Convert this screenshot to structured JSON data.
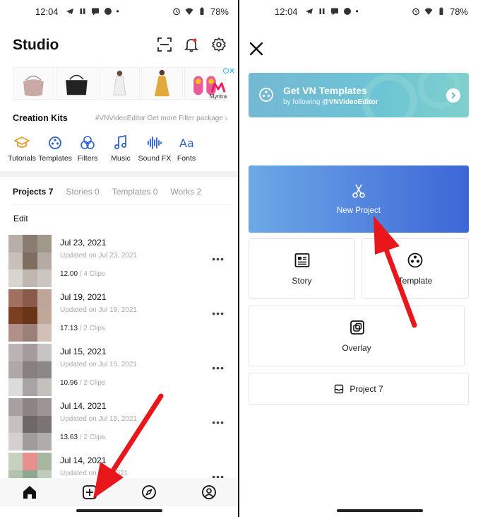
{
  "left_screen": {
    "status_bar": {
      "time": "12:04",
      "battery": "78%"
    },
    "header": {
      "title": "Studio",
      "icons": [
        "scan-icon",
        "bell-icon",
        "gear-icon"
      ]
    },
    "ad": {
      "brand": "Myntra"
    },
    "creation_kits": {
      "title": "Creation Kits",
      "more_text": "#VNVideoEditor Get more Filter package",
      "items": [
        {
          "label": "Tutorials",
          "icon": "graduation-cap-icon"
        },
        {
          "label": "Templates",
          "icon": "film-reel-icon"
        },
        {
          "label": "Filters",
          "icon": "filters-icon"
        },
        {
          "label": "Music",
          "icon": "music-note-icon"
        },
        {
          "label": "Sound FX",
          "icon": "sound-wave-icon"
        },
        {
          "label": "Fonts",
          "icon": "font-icon"
        }
      ]
    },
    "tabs": [
      {
        "label": "Projects 7"
      },
      {
        "label": "Stories 0"
      },
      {
        "label": "Templates 0"
      },
      {
        "label": "Works 2"
      }
    ],
    "edit_label": "Edit",
    "projects": [
      {
        "date": "Jul 23, 2021",
        "updated": "Updated on Jul 23, 2021",
        "duration": "12.00",
        "clips": "/ 4 Clips"
      },
      {
        "date": "Jul 19, 2021",
        "updated": "Updated on Jul 19, 2021",
        "duration": "17.13",
        "clips": "/ 2 Clips"
      },
      {
        "date": "Jul 15, 2021",
        "updated": "Updated on Jul 15, 2021",
        "duration": "10.96",
        "clips": "/ 2 Clips"
      },
      {
        "date": "Jul 14, 2021",
        "updated": "Updated on Jul 15, 2021",
        "duration": "13.63",
        "clips": "/ 2 Clips"
      },
      {
        "date": "Jul 14, 2021",
        "updated": "Updated on ...5, 2021",
        "duration": "",
        "clips": ""
      }
    ],
    "bottom_nav": [
      "home-icon",
      "add-project-icon",
      "compass-icon",
      "profile-icon"
    ]
  },
  "right_screen": {
    "status_bar": {
      "time": "12:04",
      "battery": "78%"
    },
    "banner": {
      "title": "Get VN Templates",
      "subtitle_prefix": "by following ",
      "subtitle_handle": "@VNVideoEditor"
    },
    "new_project_label": "New Project",
    "story_label": "Story",
    "template_label": "Template",
    "overlay_label": "Overlay",
    "project7_label": "Project 7"
  },
  "colors": {
    "accent_blue": "#2e61c9",
    "gradient_start": "#6da9e6",
    "gradient_end": "#3c66d6",
    "annotation_arrow": "#e8171b"
  }
}
